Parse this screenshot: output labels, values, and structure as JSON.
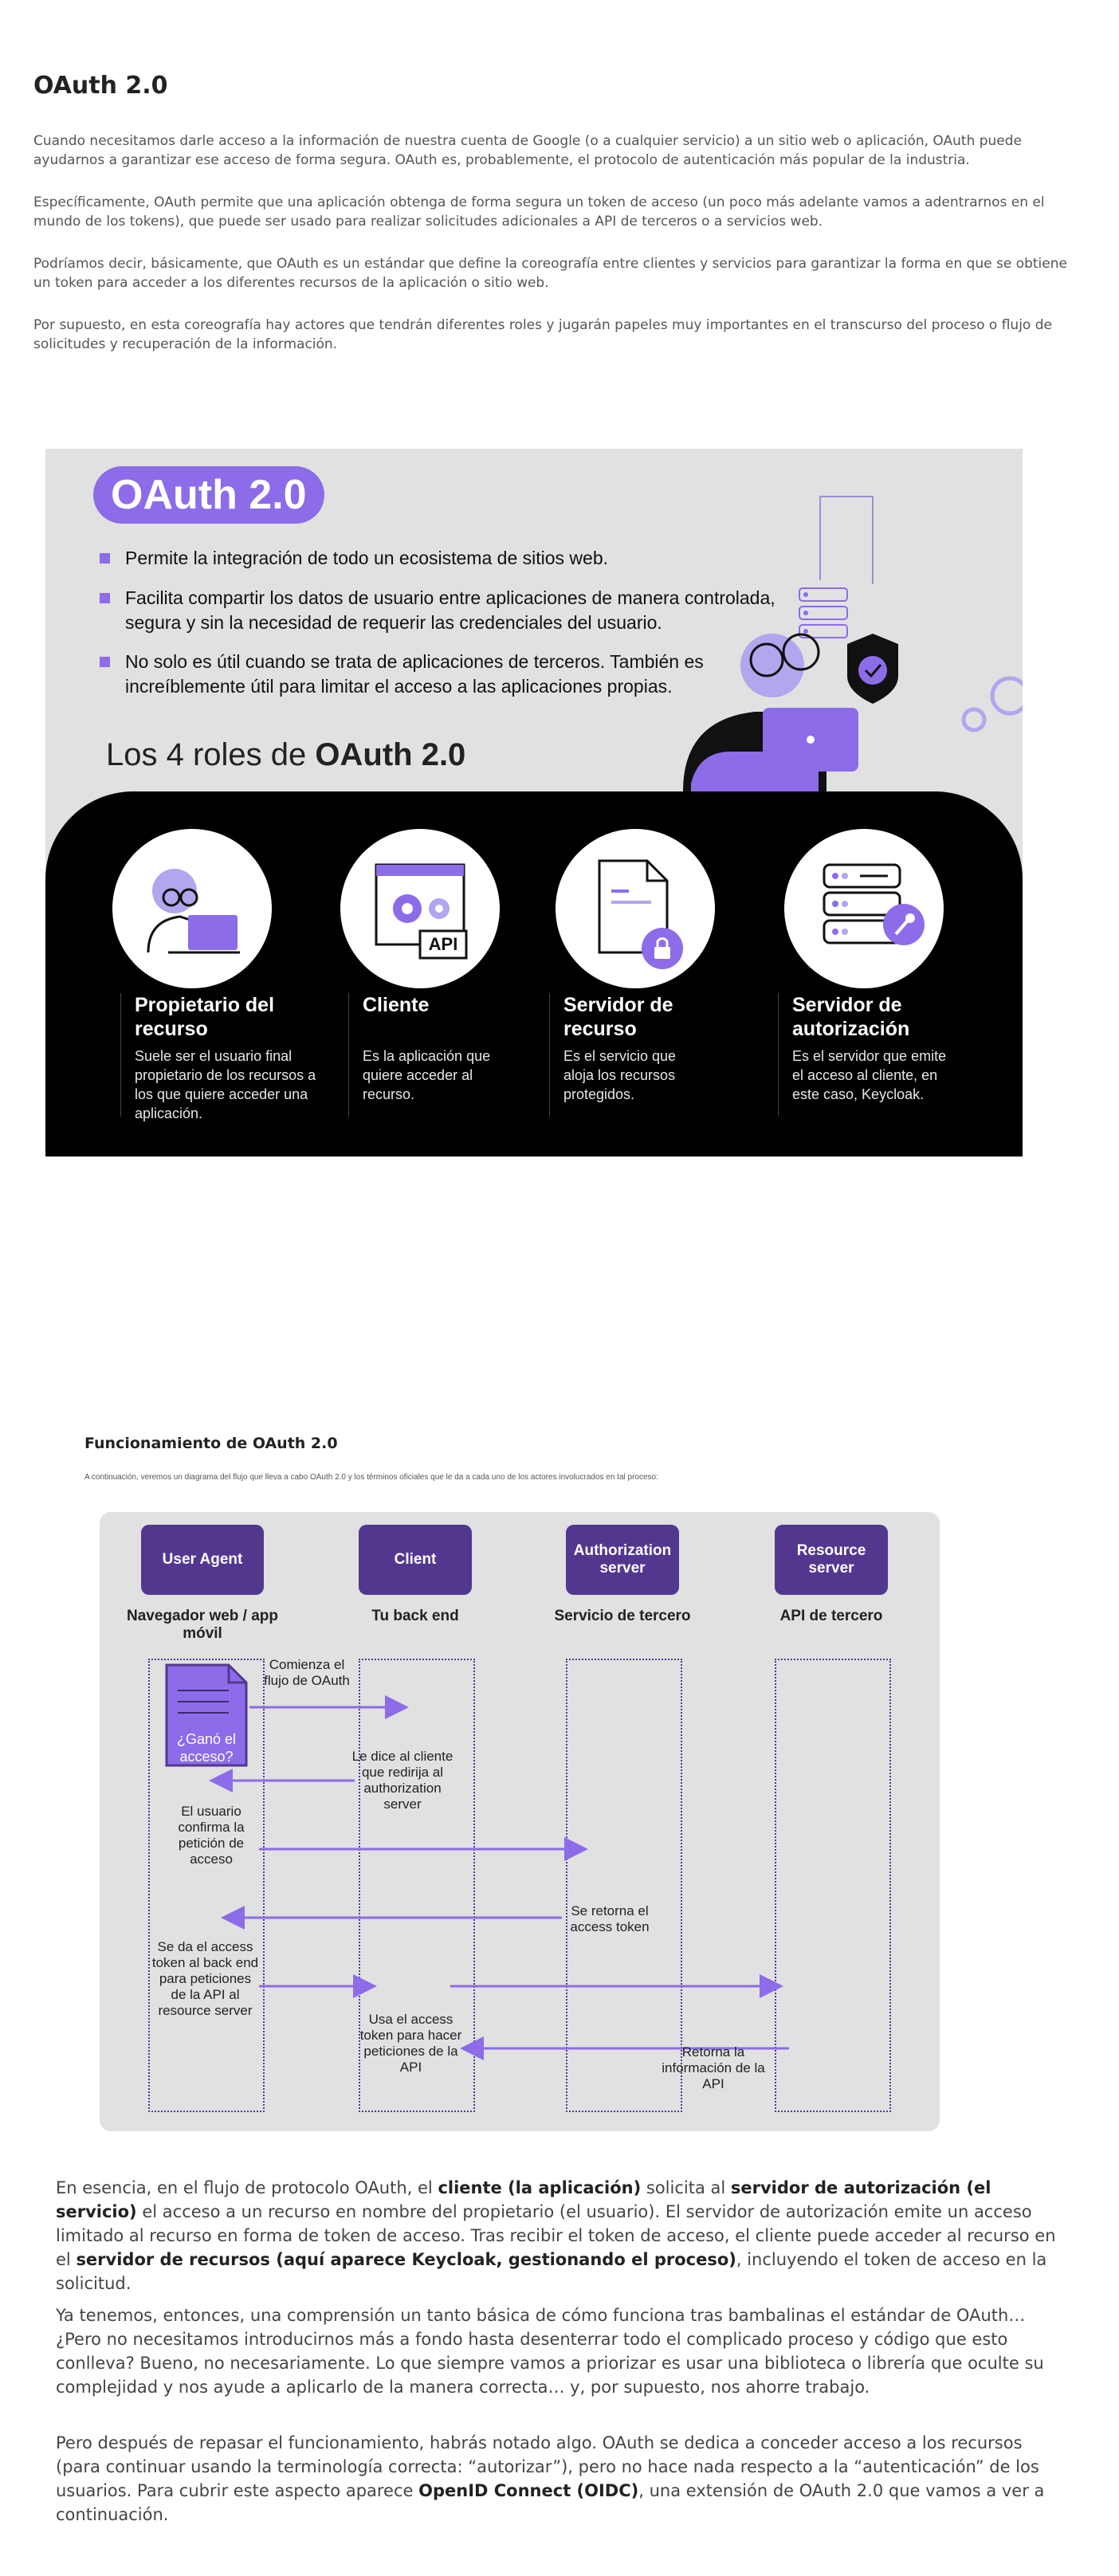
{
  "header": {
    "title": "OAuth 2.0"
  },
  "intro": [
    "Cuando necesitamos darle acceso a la información de nuestra cuenta de Google (o a cualquier servicio) a un sitio web o aplicación, OAuth puede ayudarnos a garantizar ese acceso de forma segura. OAuth es, probablemente, el protocolo de autenticación más popular de la industria.",
    "Específicamente, OAuth permite que una aplicación obtenga de forma segura un token de acceso (un poco más adelante vamos a adentrarnos en el mundo de los tokens), que puede ser usado para realizar solicitudes adicionales a API de terceros o a servicios web.",
    "Podríamos decir, básicamente, que OAuth es un estándar que define la coreografía entre clientes y servicios para garantizar la forma en que se obtiene un token para acceder a los diferentes recursos de la aplicación o sitio web.",
    "Por supuesto, en esta coreografía hay actores que tendrán diferentes roles y jugarán papeles muy importantes en el transcurso del proceso o flujo de solicitudes y recuperación de la información."
  ],
  "infographic": {
    "badge": "OAuth 2.0",
    "bullets": [
      "Permite la integración de todo un ecosistema de sitios web.",
      "Facilita compartir los datos de usuario entre aplicaciones de manera controlada, segura y sin la necesidad de requerir las credenciales del usuario.",
      "No solo es útil cuando se trata de aplicaciones de terceros. También es increíblemente útil para limitar el acceso a las aplicaciones propias."
    ],
    "roles_title_prefix": "Los 4 roles de ",
    "roles_title_bold": "OAuth 2.0",
    "roles": [
      {
        "title": "Propietario del recurso",
        "desc": "Suele ser el usuario final propietario de los recursos a los que quiere acceder una aplicación."
      },
      {
        "title": "Cliente",
        "desc": "Es la aplicación que quiere acceder al recurso."
      },
      {
        "title": "Servidor de recurso",
        "desc": "Es el servicio que aloja los recursos protegidos."
      },
      {
        "title": "Servidor de autorización",
        "desc": "Es el servidor que emite el acceso al cliente, en este caso, Keycloak."
      }
    ],
    "api_label": "API"
  },
  "flow": {
    "title": "Funcionamiento de OAuth 2.0",
    "subtitle": "A continuación, veremos un diagrama del flujo que lleva a cabo OAuth 2.0 y los términos oficiales que le da a cada uno de los actores involucrados en tal proceso:",
    "actors": [
      {
        "name": "User Agent",
        "sub": "Navegador web / app móvil"
      },
      {
        "name": "Client",
        "sub": "Tu back end"
      },
      {
        "name": "Authorization server",
        "sub": "Servicio de tercero"
      },
      {
        "name": "Resource server",
        "sub": "API de tercero"
      }
    ],
    "doc_label": "¿Ganó el acceso?",
    "messages": [
      "Comienza el flujo de OAuth",
      "Le dice al cliente que redirija al authorization server",
      "El usuario confirma la petición de acceso",
      "Se retorna el access token",
      "Se da el access token al back end para peticiones de la API al resource server",
      "Usa el access token para hacer peticiones de la API",
      "Retorna la información de la API"
    ]
  },
  "body": {
    "p1": {
      "a": "En esencia, en el flujo de protocolo OAuth, el ",
      "b": "cliente (la aplicación)",
      "c": " solicita al ",
      "d": "servidor de autorización (el servicio)",
      "e": " el acceso a un recurso en nombre del propietario (el usuario). El servidor de autorización emite un acceso limitado al recurso en forma de token de acceso. Tras recibir el token de acceso, el cliente puede acceder al recurso en el ",
      "f": "servidor de recursos (aquí aparece Keycloak, gestionando el proceso)",
      "g": ", incluyendo el token de acceso en la solicitud."
    },
    "p2": "Ya tenemos, entonces, una comprensión un tanto básica de cómo funciona tras bambalinas el estándar de OAuth… ¿Pero no necesitamos introducirnos más a fondo hasta desenterrar todo el complicado proceso y código que esto conlleva? Bueno, no necesariamente. Lo que siempre vamos a priorizar es usar una biblioteca o librería que oculte su complejidad y nos ayude a aplicarlo de la manera correcta… y, por supuesto, nos ahorre trabajo.",
    "p3": {
      "a": "Pero después de repasar el funcionamiento, habrás notado algo. OAuth se dedica a conceder acceso a los recursos (para continuar usando la terminología correcta: “autorizar”), pero no hace nada respecto a la “autenticación” de los usuarios. Para cubrir este aspecto aparece ",
      "b": "OpenID Connect (OIDC)",
      "c": ", una extensión de OAuth 2.0 que vamos a ver a continuación."
    }
  },
  "colors": {
    "accent": "#8c6ce8",
    "dark_purple": "#53378f",
    "panel_gray": "#e1e1e1",
    "black_panel": "#000000"
  }
}
